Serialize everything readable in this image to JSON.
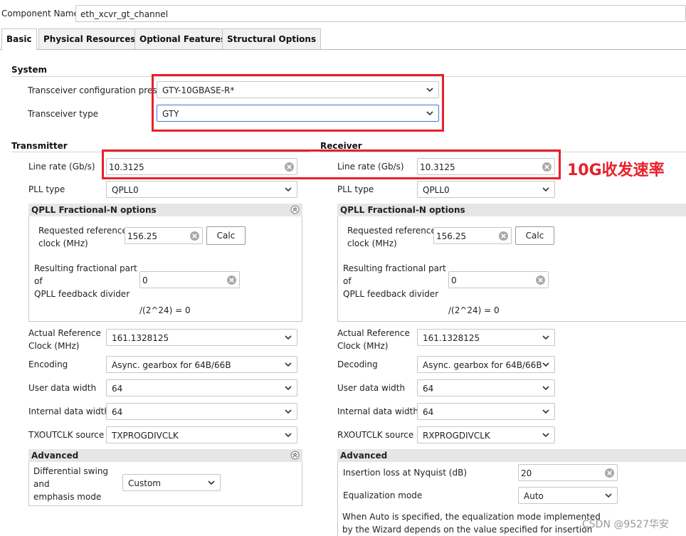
{
  "component": {
    "label": "Component Name",
    "value": "eth_xcvr_gt_channel"
  },
  "tabs": [
    "Basic",
    "Physical Resources",
    "Optional Features",
    "Structural Options"
  ],
  "system": {
    "title": "System",
    "preset_label": "Transceiver configuration preset",
    "preset_value": "GTY-10GBASE-R*",
    "type_label": "Transceiver type",
    "type_value": "GTY"
  },
  "tx": {
    "title": "Transmitter",
    "line_rate_label": "Line rate (Gb/s)",
    "line_rate_value": "10.3125",
    "pll_type_label": "PLL type",
    "pll_type_value": "QPLL0",
    "qpll": {
      "title": "QPLL Fractional-N options",
      "req_ref_label": "Requested reference\nclock (MHz)",
      "req_ref_value": "156.25",
      "calc": "Calc",
      "frac_label": "Resulting fractional part\nof\nQPLL feedback divider",
      "frac_value": "0",
      "frac_note": "/(2^24) = 0"
    },
    "actual_ref_label": "Actual Reference\nClock (MHz)",
    "actual_ref_value": "161.1328125",
    "encoding_label": "Encoding",
    "encoding_value": "Async. gearbox for 64B/66B",
    "user_width_label": "User data width",
    "user_width_value": "64",
    "internal_width_label": "Internal data width",
    "internal_width_value": "64",
    "outclk_label": "TXOUTCLK source",
    "outclk_value": "TXPROGDIVCLK",
    "advanced": {
      "title": "Advanced",
      "swing_label": "Differential swing\nand\nemphasis mode",
      "swing_value": "Custom"
    }
  },
  "rx": {
    "title": "Receiver",
    "line_rate_label": "Line rate (Gb/s)",
    "line_rate_value": "10.3125",
    "pll_type_label": "PLL type",
    "pll_type_value": "QPLL0",
    "qpll": {
      "title": "QPLL Fractional-N options",
      "req_ref_label": "Requested reference\nclock (MHz)",
      "req_ref_value": "156.25",
      "calc": "Calc",
      "frac_label": "Resulting fractional part\nof\nQPLL feedback divider",
      "frac_value": "0",
      "frac_note": "/(2^24) = 0"
    },
    "actual_ref_label": "Actual Reference\nClock (MHz)",
    "actual_ref_value": "161.1328125",
    "decoding_label": "Decoding",
    "decoding_value": "Async. gearbox for 64B/66B",
    "user_width_label": "User data width",
    "user_width_value": "64",
    "internal_width_label": "Internal data width",
    "internal_width_value": "64",
    "outclk_label": "RXOUTCLK source",
    "outclk_value": "RXPROGDIVCLK",
    "advanced": {
      "title": "Advanced",
      "insertion_label": "Insertion loss at Nyquist (dB)",
      "insertion_value": "20",
      "eq_label": "Equalization mode",
      "eq_value": "Auto",
      "note": "When Auto is specified, the equalization mode implemented\nby the Wizard depends on the value specified for insertion"
    }
  },
  "annotation": "10G收发速率",
  "watermark": "CSDN @9527华安",
  "colors": {
    "highlight": "#e8202a",
    "focus_border": "#3b7bd4",
    "group_header": "#e6e6e6"
  }
}
